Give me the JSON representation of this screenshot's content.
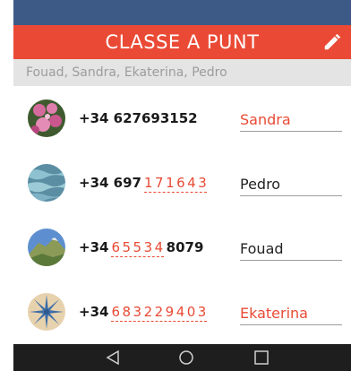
{
  "header": {
    "title": "CLASSE A PUNT",
    "edit_icon": "pencil-icon"
  },
  "members_line": "Fouad, Sandra, Ekaterina, Pedro",
  "contacts": [
    {
      "prefix": "+34 627693152",
      "handwritten": "",
      "suffix": "",
      "name": "Sandra",
      "name_color": "#e84a35",
      "avatar": "pink-flowers-image"
    },
    {
      "prefix": "+34 697",
      "handwritten": "171643",
      "suffix": "",
      "name": "Pedro",
      "name_color": "#222222",
      "avatar": "water-surface-image"
    },
    {
      "prefix": "+34",
      "handwritten": "65534",
      "suffix": "8079",
      "name": "Fouad",
      "name_color": "#222222",
      "avatar": "mountain-landscape-image"
    },
    {
      "prefix": "+34",
      "handwritten": "683229403",
      "suffix": "",
      "name": "Ekaterina",
      "name_color": "#e84a35",
      "avatar": "star-pattern-image"
    }
  ],
  "navigation": {
    "back_icon": "back-triangle-icon",
    "home_icon": "home-circle-icon",
    "recents_icon": "recents-square-icon"
  },
  "colors": {
    "status_bar": "#3d5a86",
    "header": "#ea4a35",
    "members_bg": "#e4e4e4",
    "accent": "#e84a35",
    "navbar": "#1e1e1e"
  }
}
